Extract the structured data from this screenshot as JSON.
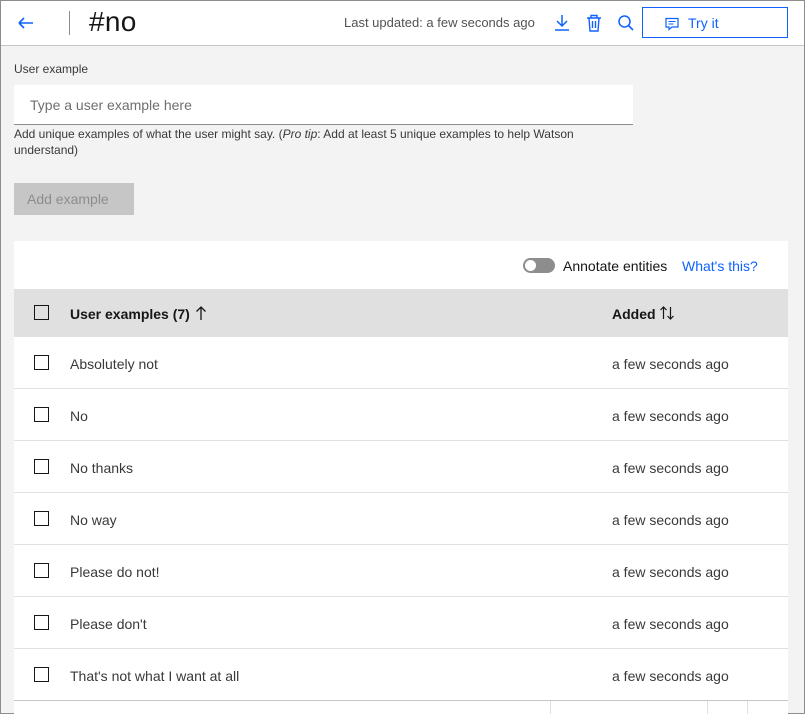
{
  "header": {
    "intent_name": "#no",
    "last_updated": "Last updated: a few seconds ago",
    "try_it_label": "Try it"
  },
  "input": {
    "label": "User example",
    "placeholder": "Type a user example here",
    "helper_prefix": "Add unique examples of what the user might say. (",
    "helper_emphasis": "Pro tip",
    "helper_suffix": ": Add at least 5 unique examples to help Watson understand)",
    "add_button_label": "Add example"
  },
  "table": {
    "annotate_label": "Annotate entities",
    "whats_this_label": "What's this?",
    "columns": {
      "examples": "User examples (7)",
      "added": "Added"
    },
    "rows": [
      {
        "text": "Absolutely not",
        "added": "a few seconds ago"
      },
      {
        "text": "No",
        "added": "a few seconds ago"
      },
      {
        "text": "No thanks",
        "added": "a few seconds ago"
      },
      {
        "text": "No way",
        "added": "a few seconds ago"
      },
      {
        "text": "Please do not!",
        "added": "a few seconds ago"
      },
      {
        "text": "Please don't",
        "added": "a few seconds ago"
      },
      {
        "text": "That's not what I want at all",
        "added": "a few seconds ago"
      }
    ]
  },
  "colors": {
    "accent": "#0f62fe",
    "background": "#f3f3f3",
    "table_header": "#e0e0e0"
  },
  "icons": [
    "arrow-left-icon",
    "download-icon",
    "trash-icon",
    "search-icon",
    "chat-icon",
    "arrow-up-icon",
    "arrows-vertical-icon"
  ]
}
